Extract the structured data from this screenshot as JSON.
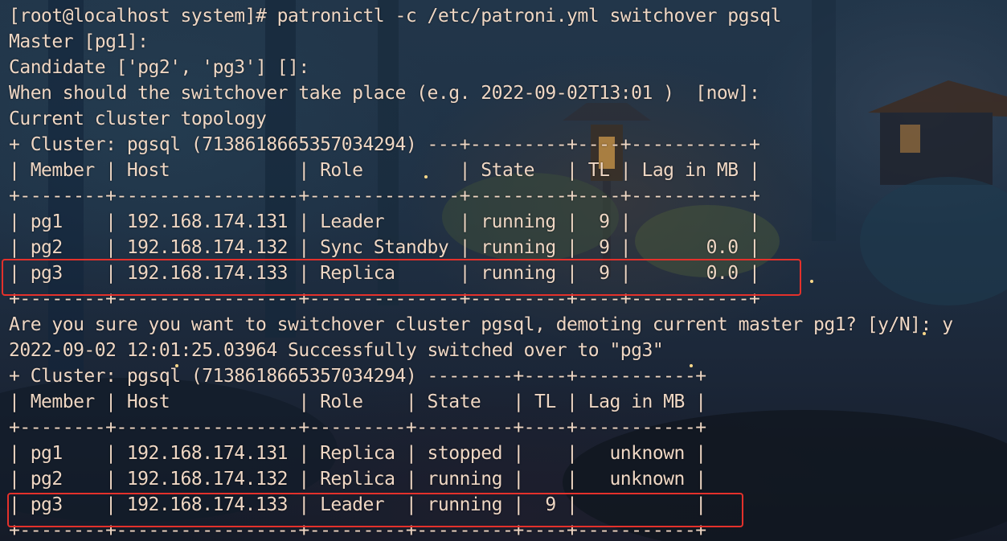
{
  "terminal": {
    "lines": [
      "[root@localhost system]# patronictl -c /etc/patroni.yml switchover pgsql",
      "Master [pg1]:",
      "Candidate ['pg2', 'pg3'] []:",
      "When should the switchover take place (e.g. 2022-09-02T13:01 )  [now]:",
      "Current cluster topology",
      "+ Cluster: pgsql (7138618665357034294) ---+---------+----+-----------+",
      "| Member | Host            | Role         | State   | TL | Lag in MB |",
      "+--------+-----------------+--------------+---------+----+-----------+",
      "| pg1    | 192.168.174.131 | Leader       | running |  9 |           |",
      "| pg2    | 192.168.174.132 | Sync Standby | running |  9 |       0.0 |",
      "| pg3    | 192.168.174.133 | Replica      | running |  9 |       0.0 |",
      "+--------+-----------------+--------------+---------+----+-----------+",
      "Are you sure you want to switchover cluster pgsql, demoting current master pg1? [y/N]: y",
      "2022-09-02 12:01:25.03964 Successfully switched over to \"pg3\"",
      "+ Cluster: pgsql (7138618665357034294) --------+----+-----------+",
      "| Member | Host            | Role    | State   | TL | Lag in MB |",
      "+--------+-----------------+---------+---------+----+-----------+",
      "| pg1    | 192.168.174.131 | Replica | stopped |    |   unknown |",
      "| pg2    | 192.168.174.132 | Replica | running |    |   unknown |",
      "| pg3    | 192.168.174.133 | Leader  | running |  9 |           |",
      "+--------+-----------------+---------+---------+----+-----------+"
    ]
  },
  "colors": {
    "text": "#efd7c4",
    "highlight_border": "#e4312b"
  }
}
